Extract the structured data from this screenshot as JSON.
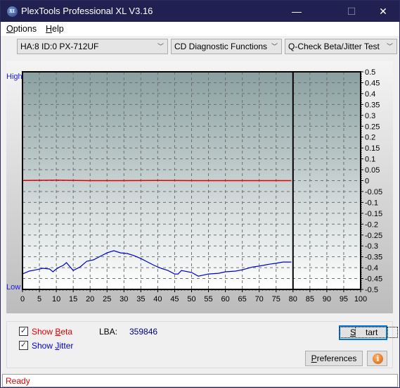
{
  "window": {
    "title": "PlexTools Professional XL V3.16",
    "app_icon_text": "XL",
    "minimize": "—",
    "maximize": "☐",
    "close": "✕"
  },
  "menu": {
    "items": [
      {
        "label": "Options",
        "accel": "O"
      },
      {
        "label": "Help",
        "accel": "H"
      }
    ]
  },
  "toolbar": {
    "drive": "HA:8 ID:0  PX-712UF",
    "function": "CD Diagnostic Functions",
    "test": "Q-Check Beta/Jitter Test",
    "arrow": "﹀"
  },
  "chart_data": {
    "type": "line",
    "title": "",
    "xlabel": "",
    "ylabel_top": "High",
    "ylabel_bottom": "Low",
    "xlim": [
      0,
      100
    ],
    "ylim": [
      -0.5,
      0.5
    ],
    "x_ticks": [
      0,
      5,
      10,
      15,
      20,
      25,
      30,
      35,
      40,
      45,
      50,
      55,
      60,
      65,
      70,
      75,
      80,
      85,
      90,
      95,
      100
    ],
    "y_ticks": [
      0.5,
      0.45,
      0.4,
      0.35,
      0.3,
      0.25,
      0.2,
      0.15,
      0.1,
      0.05,
      0,
      -0.05,
      -0.1,
      -0.15,
      -0.2,
      -0.25,
      -0.3,
      -0.35,
      -0.4,
      -0.45,
      -0.5
    ],
    "disc_end_marker": 80,
    "grid": true,
    "series": [
      {
        "name": "Beta",
        "color": "#e00000",
        "x": [
          0,
          10,
          20,
          30,
          40,
          50,
          60,
          70,
          79.5
        ],
        "values": [
          0.001,
          0.002,
          0.0,
          0.0,
          0.001,
          0.0,
          0.0,
          0.0,
          0.0
        ]
      },
      {
        "name": "Jitter",
        "color": "#0000d0",
        "x": [
          0,
          2,
          4,
          6,
          8,
          9,
          10,
          11,
          12,
          13,
          15,
          17,
          19,
          21,
          23,
          25,
          27,
          29,
          31,
          33,
          35,
          37,
          39,
          41,
          43,
          45,
          46,
          47,
          50,
          52,
          55,
          58,
          60,
          63,
          65,
          68,
          70,
          73,
          75,
          77,
          79.5
        ],
        "values": [
          -0.429,
          -0.416,
          -0.41,
          -0.403,
          -0.406,
          -0.419,
          -0.406,
          -0.397,
          -0.39,
          -0.377,
          -0.413,
          -0.397,
          -0.371,
          -0.364,
          -0.348,
          -0.332,
          -0.322,
          -0.332,
          -0.335,
          -0.345,
          -0.358,
          -0.374,
          -0.39,
          -0.403,
          -0.413,
          -0.429,
          -0.429,
          -0.413,
          -0.422,
          -0.439,
          -0.429,
          -0.426,
          -0.419,
          -0.416,
          -0.41,
          -0.397,
          -0.393,
          -0.384,
          -0.38,
          -0.374,
          -0.374
        ]
      }
    ]
  },
  "controls": {
    "show_beta": {
      "label_pre": "Show ",
      "accel": "B",
      "label_post": "eta",
      "checked": true,
      "check": "✓",
      "color": "#e00000"
    },
    "show_jitter": {
      "label_pre": "Show ",
      "accel": "J",
      "label_post": "itter",
      "checked": true,
      "check": "✓",
      "color": "#0000d0"
    },
    "lba_label": "LBA:",
    "lba_value": "359846",
    "start_accel": "S",
    "start_rest": "tart",
    "pref_accel": "P",
    "pref_rest": "references",
    "info_glyph": "i"
  },
  "status": {
    "text": "Ready"
  }
}
